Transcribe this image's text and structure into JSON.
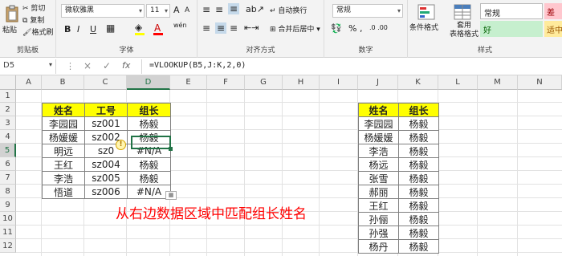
{
  "ribbon": {
    "clipboard": {
      "cut": "剪切",
      "copy": "复制",
      "format_painter": "格式刷",
      "paste": "粘贴",
      "label": "剪贴板"
    },
    "font": {
      "name": "微软雅黑",
      "size": "11",
      "grow": "A",
      "shrink": "A",
      "bold": "B",
      "italic": "I",
      "underline": "U",
      "color_a": "A",
      "wen": "wén",
      "label": "字体"
    },
    "alignment": {
      "wrap": "自动换行",
      "merge": "合并后居中",
      "label": "对齐方式"
    },
    "number": {
      "format": "常规",
      "percent": "%",
      "comma": ",",
      "inc": ".0 .00",
      "label": "数字"
    },
    "styles": {
      "cond": "条件格式",
      "table": "套用\n表格格式",
      "normal": "常规",
      "bad": "差",
      "good": "好",
      "neutral": "适中",
      "label": "样式"
    }
  },
  "formula_bar": {
    "name_box": "D5",
    "cancel": "×",
    "enter": "✓",
    "fx": "fx",
    "formula": "=VLOOKUP(B5,J:K,2,0)"
  },
  "columns": [
    "A",
    "B",
    "C",
    "D",
    "E",
    "F",
    "G",
    "H",
    "I",
    "J",
    "K",
    "L",
    "M",
    "N"
  ],
  "rows": [
    "1",
    "2",
    "3",
    "4",
    "5",
    "6",
    "7",
    "8",
    "9",
    "10",
    "11",
    "12"
  ],
  "left_table": {
    "headers": [
      "姓名",
      "工号",
      "组长"
    ],
    "rows": [
      [
        "李园园",
        "sz001",
        "杨毅"
      ],
      [
        "杨媛媛",
        "sz002",
        "杨毅"
      ],
      [
        "明远",
        "sz0",
        "#N/A"
      ],
      [
        "王红",
        "sz004",
        "杨毅"
      ],
      [
        "李浩",
        "sz005",
        "杨毅"
      ],
      [
        "悟道",
        "sz006",
        "#N/A"
      ]
    ]
  },
  "right_table": {
    "headers": [
      "姓名",
      "组长"
    ],
    "rows": [
      [
        "李园园",
        "杨毅"
      ],
      [
        "杨媛媛",
        "杨毅"
      ],
      [
        "李浩",
        "杨毅"
      ],
      [
        "杨远",
        "杨毅"
      ],
      [
        "张雪",
        "杨毅"
      ],
      [
        "郝丽",
        "杨毅"
      ],
      [
        "王红",
        "杨毅"
      ],
      [
        "孙俪",
        "杨毅"
      ],
      [
        "孙强",
        "杨毅"
      ],
      [
        "杨丹",
        "杨毅"
      ]
    ]
  },
  "annotation": "从右边数据区域中匹配组长姓名",
  "colors": {
    "header_fill": "#ffff00",
    "annotation": "#ff0000",
    "good": "#c6efce",
    "bad": "#ffc7ce",
    "neutral": "#ffeb9c"
  }
}
